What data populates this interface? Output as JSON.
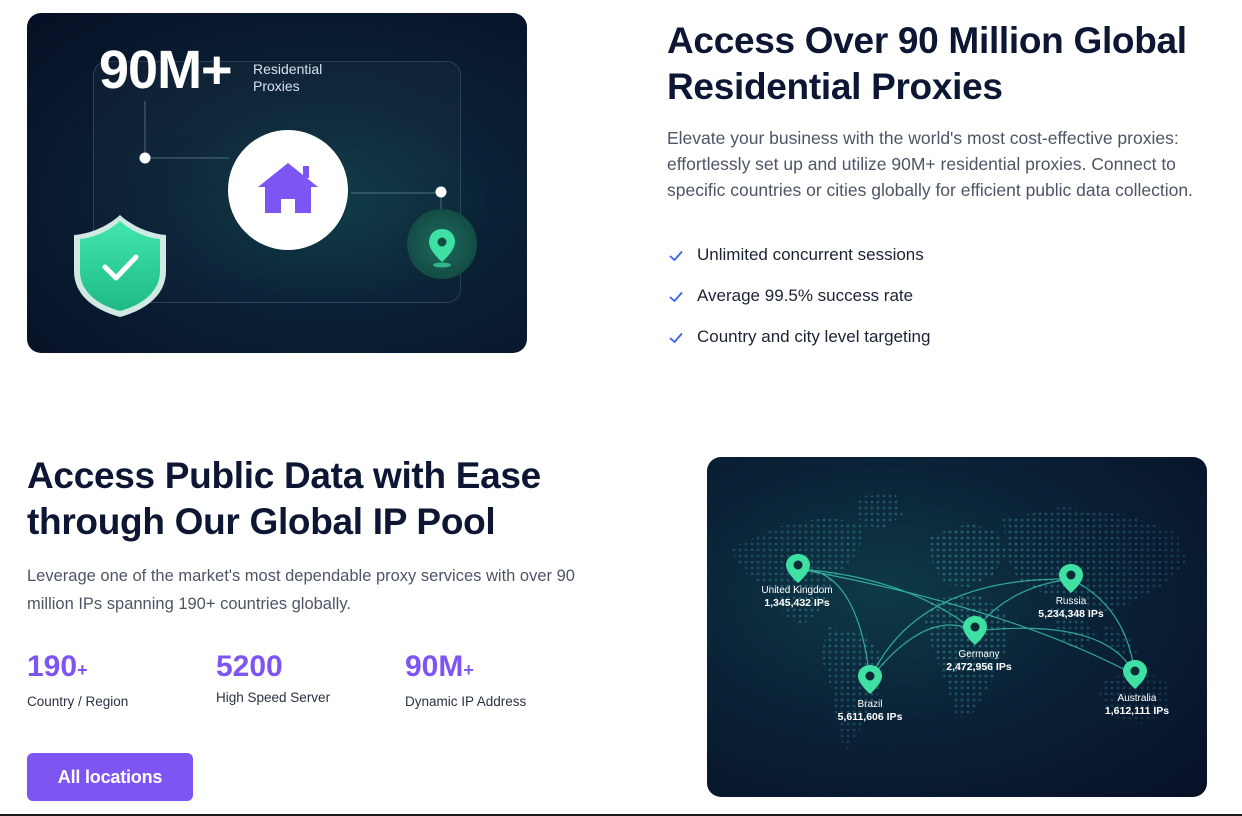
{
  "hero": {
    "big_value": "90M+",
    "small_label": "Residential Proxies",
    "icons": [
      "house-icon",
      "shield-check-icon",
      "location-pin-icon"
    ]
  },
  "section1": {
    "title": "Access Over 90 Million Global Residential Proxies",
    "description": "Elevate your business with the world's most cost-effective proxies: effortlessly set up and utilize 90M+ residential proxies. Connect to specific countries or cities globally for efficient public data collection.",
    "features": [
      "Unlimited concurrent sessions",
      "Average 99.5% success rate",
      "Country and city level targeting"
    ]
  },
  "section2": {
    "title": "Access Public Data with Ease through Our Global IP Pool",
    "description": "Leverage one of the market's most dependable proxy services with over 90 million IPs spanning 190+ countries globally.",
    "stats": [
      {
        "value": "190",
        "suffix": "+",
        "label": "Country / Region"
      },
      {
        "value": "5200",
        "suffix": "",
        "label": "High Speed Server"
      },
      {
        "value": "90M",
        "suffix": "+",
        "label": "Dynamic IP Address"
      }
    ],
    "cta_label": "All locations"
  },
  "map": {
    "locations": [
      {
        "name": "United Kingdom",
        "ips": "1,345,432 IPs"
      },
      {
        "name": "Russia",
        "ips": "5,234,348 IPs"
      },
      {
        "name": "Germany",
        "ips": "2,472,956 IPs"
      },
      {
        "name": "Brazil",
        "ips": "5,611,606 IPs"
      },
      {
        "name": "Australia",
        "ips": "1,612,111 IPs"
      }
    ]
  },
  "colors": {
    "accent": "#7c55f2",
    "mint": "#3ee0a3",
    "dark_navy": "#0d1733",
    "card_bg": "#071026"
  }
}
